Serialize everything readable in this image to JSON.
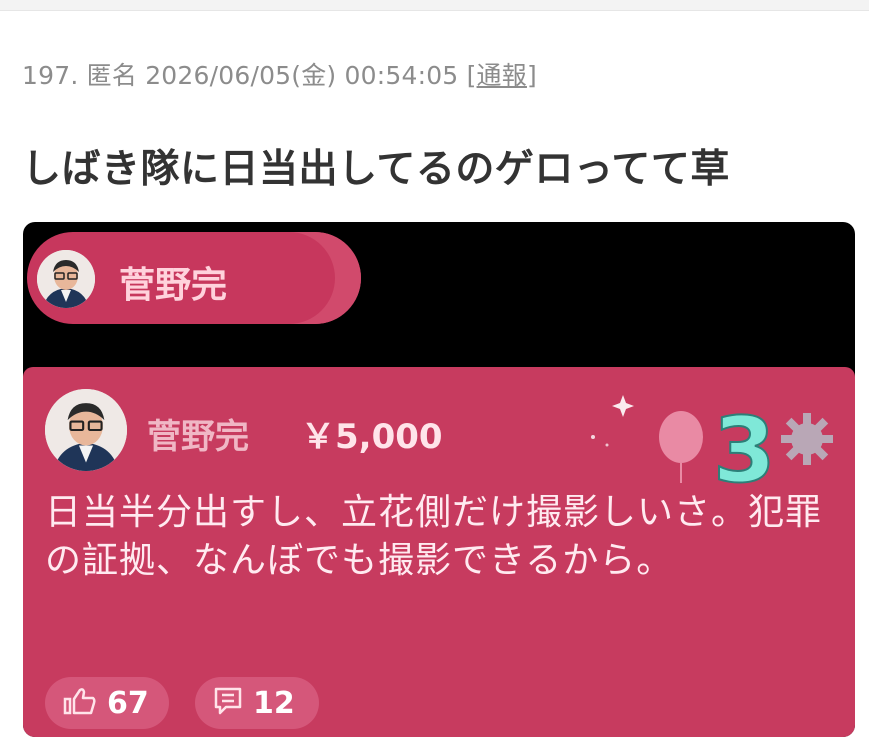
{
  "post": {
    "number": "197.",
    "author": "匿名",
    "datetime": "2026/06/05(金) 00:54:05",
    "report_open": "[",
    "report_label": "通報",
    "report_close": "]",
    "body": "しばき隊に日当出してるのゲロってて草"
  },
  "embed": {
    "pill_name": "菅野完",
    "card": {
      "name": "菅野完",
      "amount": "￥5,000",
      "message": "日当半分出すし、立花側だけ撮影しいさ。犯罪の証拠、なんぼでも撮影できるから。",
      "badge_number": "3",
      "likes": "67",
      "comments": "12"
    },
    "colors": {
      "card_bg": "#c73b5f",
      "pill_bg": "#c7375d",
      "stat_bg": "#d5577a",
      "badge_number": "#7fe8d8"
    },
    "icons": {
      "like": "thumbs-up-icon",
      "comment": "comment-list-icon",
      "balloon": "balloon-icon",
      "gear": "gear-icon",
      "sparkle": "sparkle-icon"
    }
  }
}
